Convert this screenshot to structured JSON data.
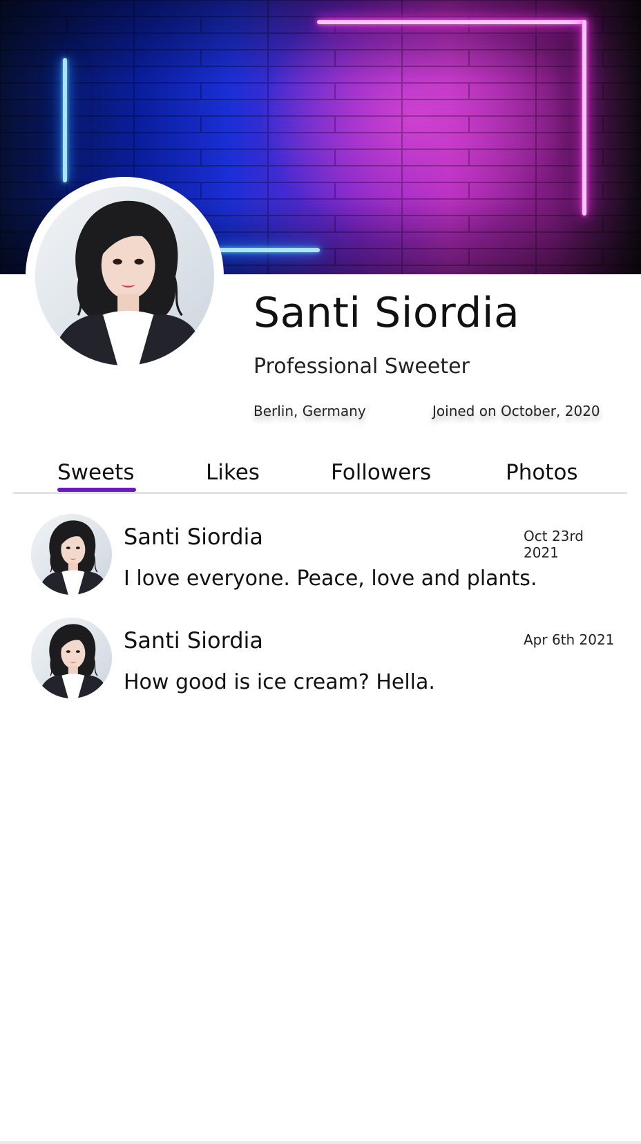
{
  "profile": {
    "name": "Santi Siordia",
    "bio": "Professional Sweeter",
    "location": "Berlin, Germany",
    "joined": "Joined on October, 2020"
  },
  "tabs": [
    {
      "label": "Sweets",
      "active": true
    },
    {
      "label": "Likes",
      "active": false
    },
    {
      "label": "Followers",
      "active": false
    },
    {
      "label": "Photos",
      "active": false
    }
  ],
  "posts": [
    {
      "author": "Santi Siordia",
      "date": "Oct 23rd 2021",
      "text": "I love everyone. Peace, love and plants."
    },
    {
      "author": "Santi Siordia",
      "date": "Apr 6th 2021",
      "text": "How good is ice cream? Hella."
    }
  ],
  "colors": {
    "accent": "#6a1bb8",
    "neon_blue": "#59c8ff",
    "neon_pink": "#ff2fe3"
  },
  "icons": [
    "avatar-portrait"
  ]
}
